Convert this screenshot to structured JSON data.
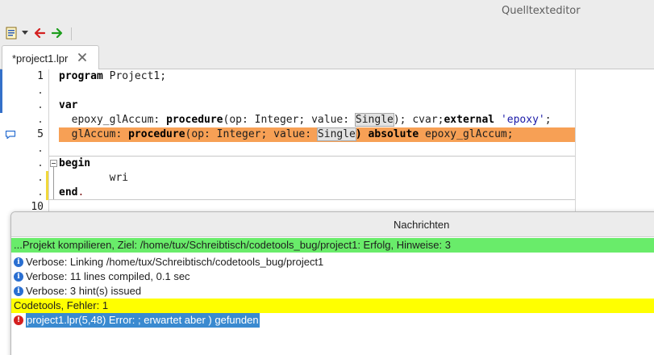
{
  "window": {
    "title": "Quelltexteditor"
  },
  "toolbar": {
    "buttons": [
      {
        "icon": "list-toggle-icon"
      },
      {
        "icon": "dropdown-arrow-icon"
      },
      {
        "icon": "back-arrow-icon",
        "color": "#d42020"
      },
      {
        "icon": "forward-arrow-icon",
        "color": "#1e9e1e"
      }
    ]
  },
  "tabs": [
    {
      "label": "*project1.lpr",
      "close_icon": "close-icon"
    }
  ],
  "editor": {
    "line_numbers": [
      "1",
      ".",
      ".",
      ".",
      "5",
      ".",
      ".",
      ".",
      ".",
      "10"
    ],
    "lines": {
      "l1_kw": "program",
      "l1_rest": " Project1;",
      "l3_kw": "var",
      "l4_a": "  epoxy_glAccum: ",
      "l4_kw1": "procedure",
      "l4_b": "(op: Integer; value: ",
      "l4_word": "Single",
      "l4_c": "); cvar;",
      "l4_kw2": "external",
      "l4_d": " ",
      "l4_str": "'epoxy'",
      "l4_e": ";",
      "l5_a": "  glAccum: ",
      "l5_kw1": "procedure",
      "l5_b": "(op: Integer; value: ",
      "l5_word": "Single",
      "l5_c": ") ",
      "l5_kw2": "absolute",
      "l5_d": " epoxy_glAccum;",
      "l7_kw": "begin",
      "l8": "        wri",
      "l9_kw": "end",
      "l9_rest": "."
    },
    "highlight_color": "#f7a055"
  },
  "messages": {
    "title": "Nachrichten",
    "rows": [
      {
        "text": "...Projekt kompilieren, Ziel: /home/tux/Schreibtisch/codetools_bug/project1: Erfolg, Hinweise: 3",
        "color": "#69ec6a"
      },
      {
        "text": "Verbose: Linking /home/tux/Schreibtisch/codetools_bug/project1",
        "icon": "info-icon"
      },
      {
        "text": "Verbose: 11 lines compiled, 0.1 sec",
        "icon": "info-icon"
      },
      {
        "text": "Verbose: 3 hint(s) issued",
        "icon": "info-icon"
      },
      {
        "text": "Codetools, Fehler: 1",
        "color": "#ffff00"
      },
      {
        "text": "project1.lpr(5,48) Error: ; erwartet aber ) gefunden",
        "icon": "error-icon",
        "selected": true
      }
    ]
  }
}
